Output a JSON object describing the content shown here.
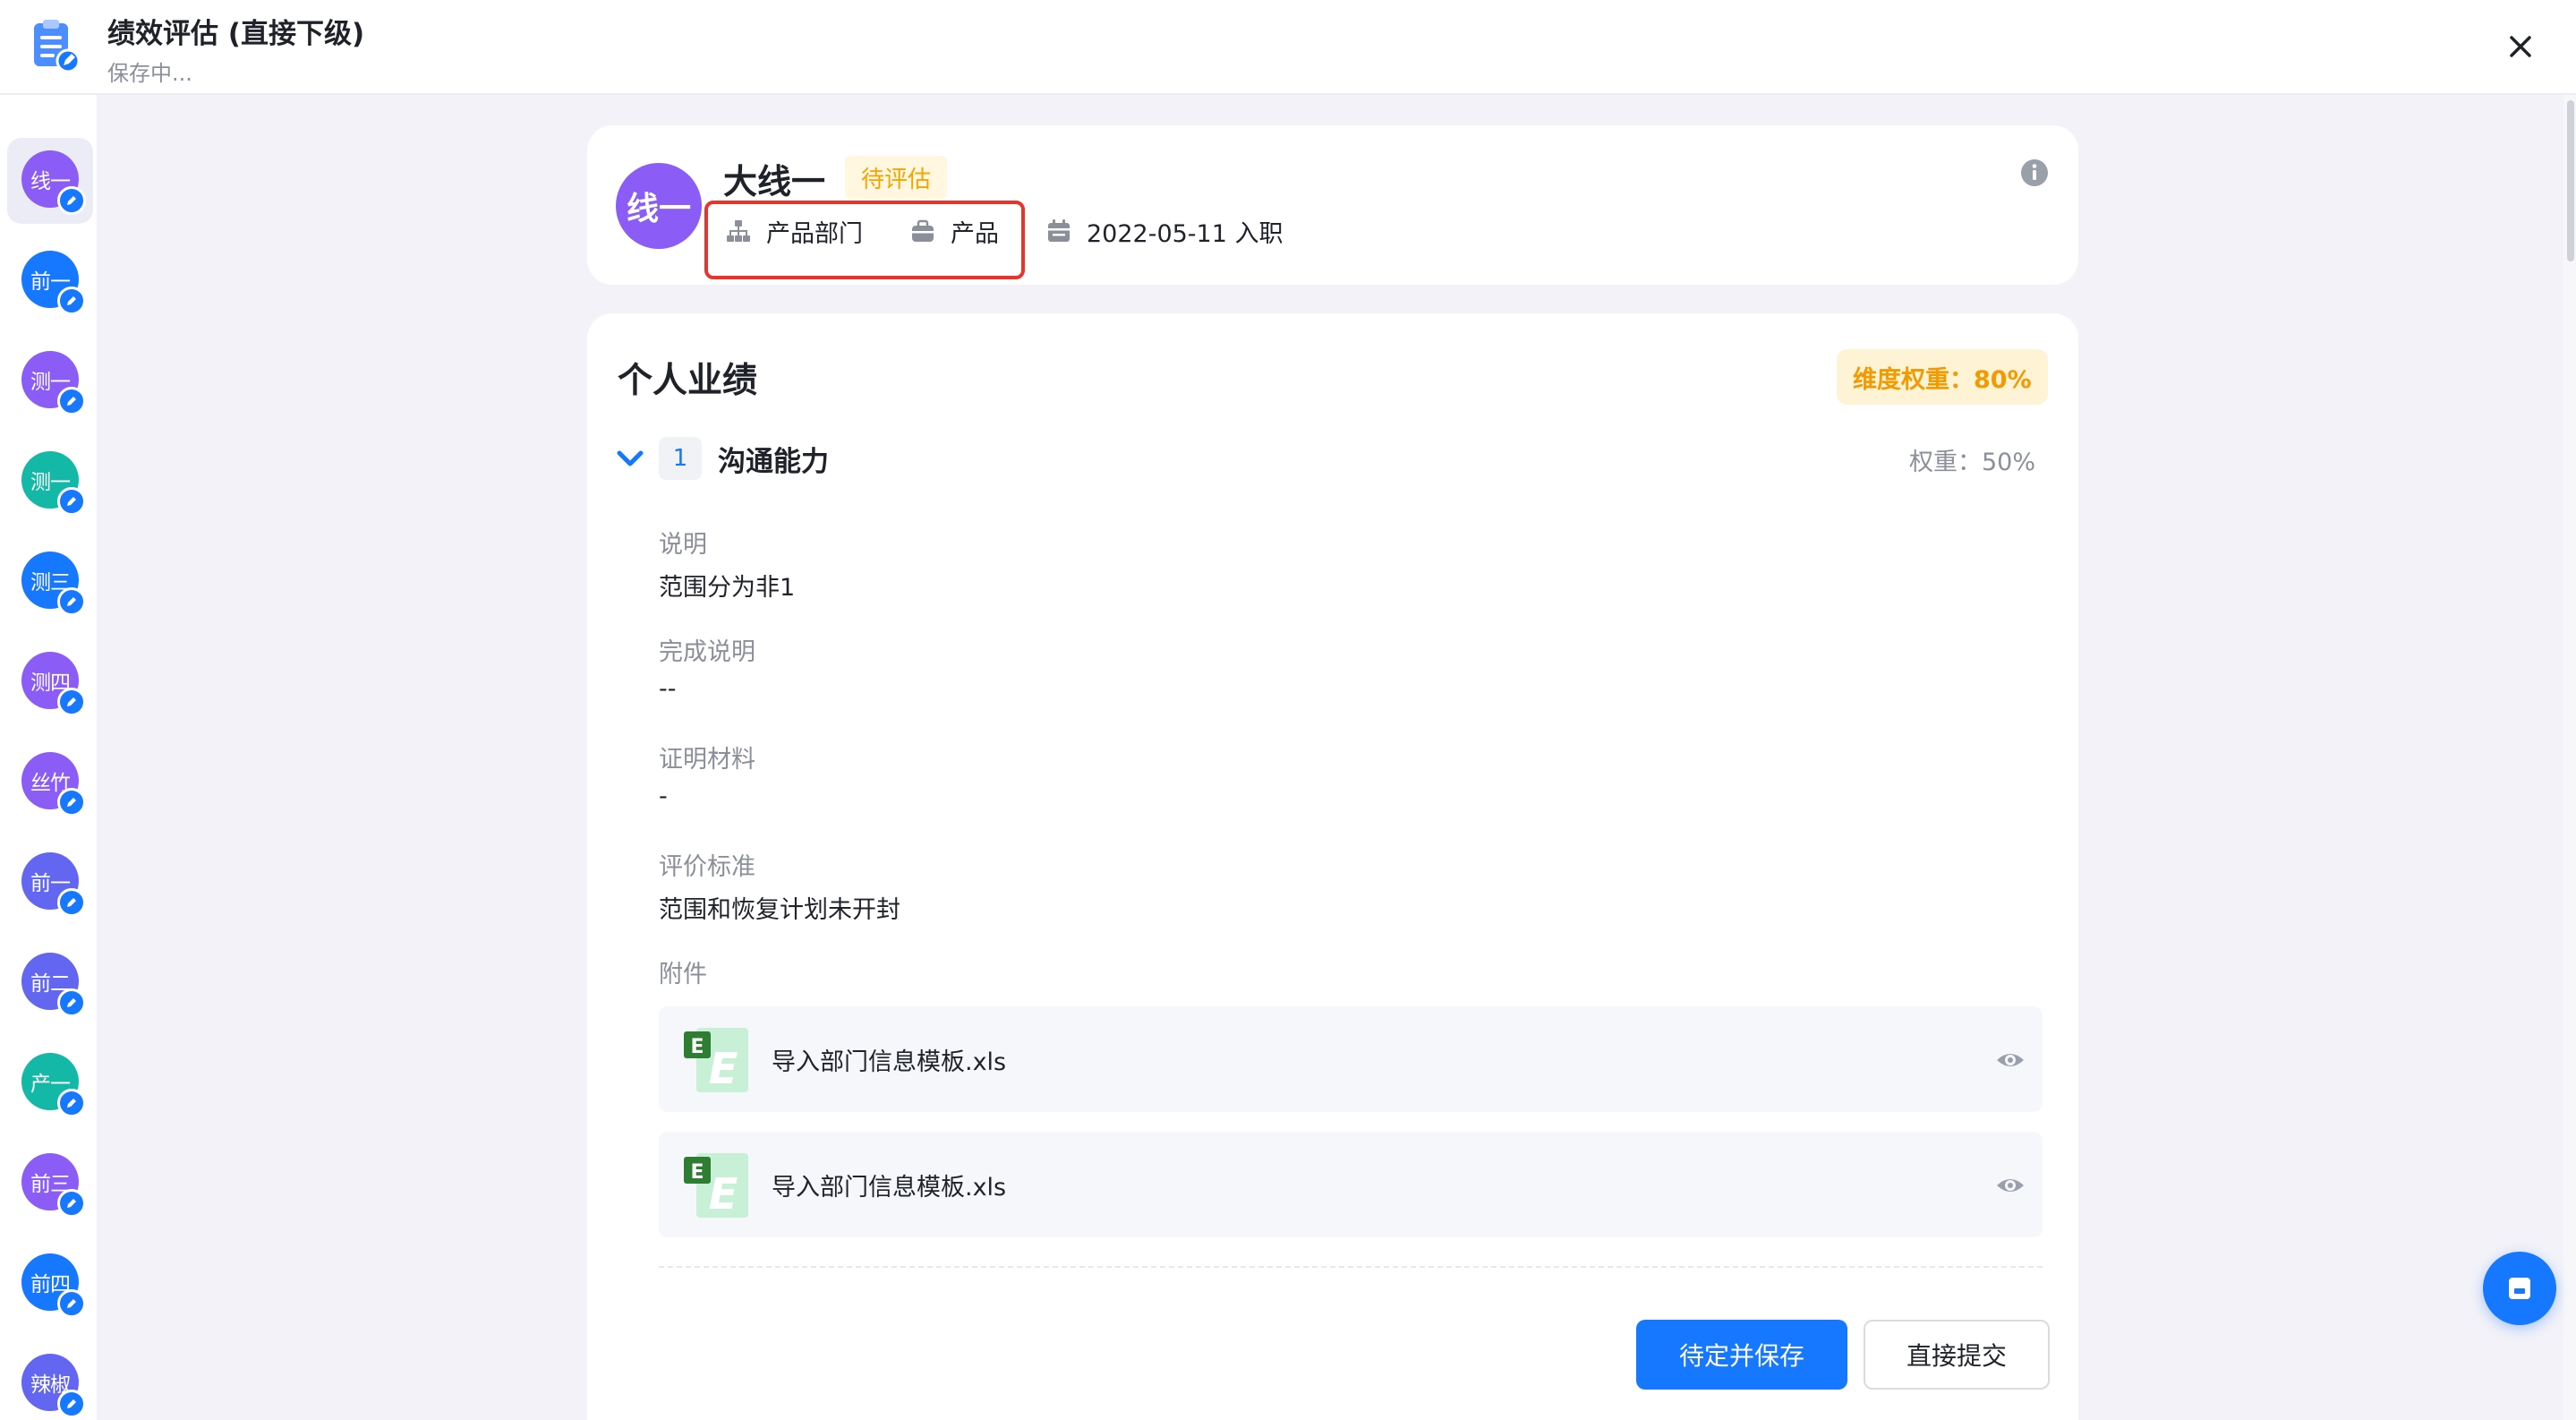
{
  "header": {
    "title": "绩效评估 (直接下级)",
    "subtitle": "保存中..."
  },
  "sidebar": {
    "items": [
      {
        "label": "线一",
        "color": "#8b5cf6"
      },
      {
        "label": "前一",
        "color": "#1677ff"
      },
      {
        "label": "测一",
        "color": "#8b5cf6"
      },
      {
        "label": "测一",
        "color": "#14b8a6"
      },
      {
        "label": "测三",
        "color": "#1677ff"
      },
      {
        "label": "测四",
        "color": "#8b5cf6"
      },
      {
        "label": "丝竹",
        "color": "#8b5cf6"
      },
      {
        "label": "前一",
        "color": "#6366f1"
      },
      {
        "label": "前二",
        "color": "#6366f1"
      },
      {
        "label": "产一",
        "color": "#14b8a6"
      },
      {
        "label": "前三",
        "color": "#8b5cf6"
      },
      {
        "label": "前四",
        "color": "#1677ff"
      },
      {
        "label": "辣椒",
        "color": "#6366f1"
      }
    ]
  },
  "profile": {
    "avatar_text": "线一",
    "name": "大线一",
    "status": "待评估",
    "department": "产品部门",
    "position": "产品",
    "join_date": "2022-05-11 入职"
  },
  "performance": {
    "section_title": "个人业绩",
    "dimension_weight": "维度权重：80%",
    "item": {
      "index": "1",
      "title": "沟通能力",
      "weight": "权重：50%",
      "fields": [
        {
          "label": "说明",
          "value": "范围分为非1"
        },
        {
          "label": "完成说明",
          "value": "--"
        },
        {
          "label": "证明材料",
          "value": "-"
        },
        {
          "label": "评价标准",
          "value": "范围和恢复计划未开封"
        }
      ],
      "attachments_label": "附件",
      "attachments": [
        {
          "name": "导入部门信息模板.xls"
        },
        {
          "name": "导入部门信息模板.xls"
        }
      ]
    }
  },
  "actions": {
    "save_draft": "待定并保存",
    "submit": "直接提交"
  },
  "colors": {
    "accent": "#1677ff",
    "status_tag": "#f5a400",
    "highlight": "#e8352c"
  }
}
